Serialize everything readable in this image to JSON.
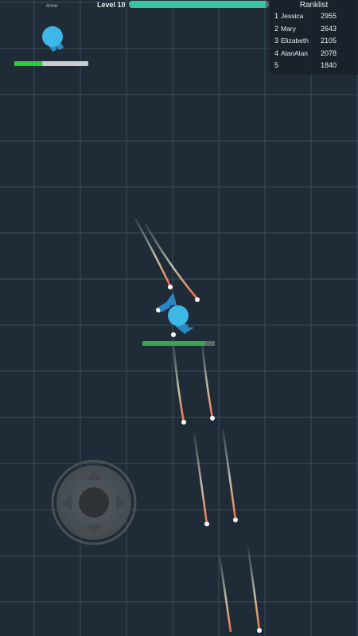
{
  "hud": {
    "level_label": "Level 10",
    "level_progress": 0.98,
    "colors": {
      "accent": "#39c3a5",
      "player": "#3cb7e6",
      "health": "#2ecc3a"
    }
  },
  "ranklist": {
    "title": "Ranklist",
    "entries": [
      {
        "rank": "1",
        "name": "Jessica",
        "score": "2955"
      },
      {
        "rank": "2",
        "name": "Mary",
        "score": "2643"
      },
      {
        "rank": "3",
        "name": "Elizabeth",
        "score": "2105"
      },
      {
        "rank": "4",
        "name": "AlanAlan",
        "score": "2078"
      },
      {
        "rank": "5",
        "name": "",
        "score": "1840"
      }
    ]
  },
  "enemy": {
    "name": "Anne",
    "health": 0.38
  },
  "player": {
    "health": 0.87
  },
  "joystick": {
    "icon": "dpad-joystick-icon"
  }
}
